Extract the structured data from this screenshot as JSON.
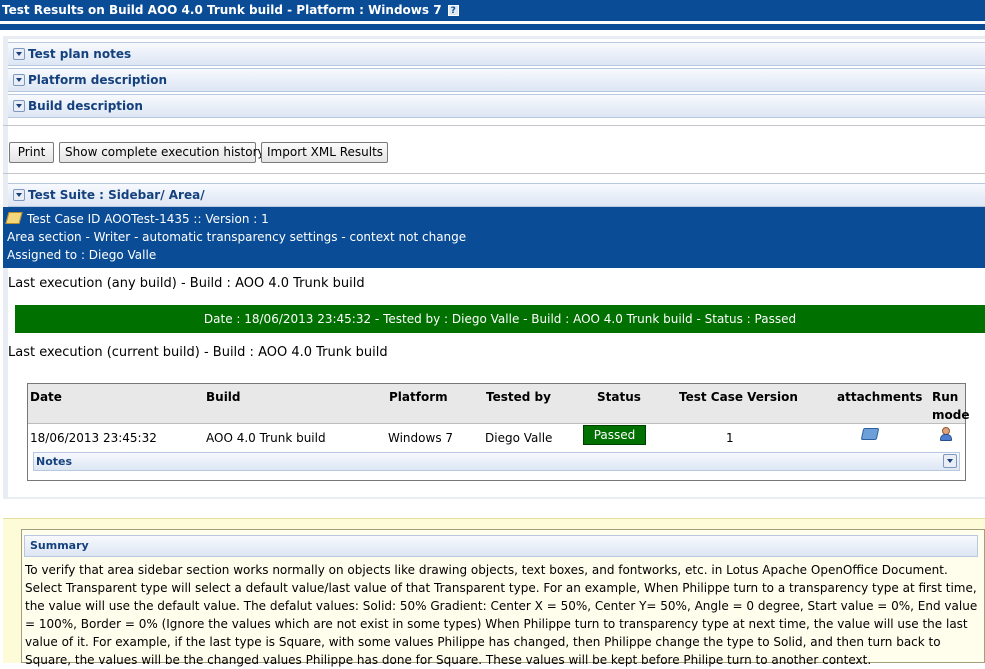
{
  "header": {
    "title": "Test Results on Build AOO 4.0 Trunk build - Platform : Windows 7",
    "help_icon": "?"
  },
  "sections": {
    "test_plan_notes": "Test plan notes",
    "platform_description": "Platform description",
    "build_description": "Build description"
  },
  "toolbar": {
    "print": "Print",
    "history": "Show complete execution history",
    "import_xml": "Import XML Results"
  },
  "test_suite": "Test Suite : Sidebar/ Area/",
  "test_case": {
    "id_line": "Test Case ID AOOTest-1435 :: Version : 1",
    "title": "Area section - Writer - automatic transparency settings - context not change",
    "assigned": "Assigned to : Diego Valle"
  },
  "last_exec_any": "Last execution (any build) - Build : AOO 4.0 Trunk build",
  "exec_banner": "Date : 18/06/2013 23:45:32 - Tested by : Diego Valle - Build : AOO 4.0 Trunk build - Status : Passed",
  "last_exec_current": "Last execution (current build) - Build : AOO 4.0 Trunk build",
  "table": {
    "headers": {
      "date": "Date",
      "build": "Build",
      "platform": "Platform",
      "tested_by": "Tested by",
      "status": "Status",
      "tc_version": "Test Case Version",
      "attachments": "attachments",
      "run_mode_1": "Run",
      "run_mode_2": "mode"
    },
    "row": {
      "date": "18/06/2013 23:45:32",
      "build": "AOO 4.0 Trunk build",
      "platform": "Windows 7",
      "tested_by": "Diego Valle",
      "status": "Passed",
      "tc_version": "1"
    },
    "notes": "Notes"
  },
  "summary": {
    "header": "Summary",
    "text": "To verify that area sidebar section works normally on objects like drawing objects, text boxes, and fontworks, etc. in Lotus Apache OpenOffice Document. Select Transparent type will select a default value/last value of that Transparent type. For an example, When Philippe turn to a transparency type at first time, the value will use the default value. The defalut values: Solid: 50% Gradient: Center X = 50%, Center Y= 50%, Angle = 0 degree, Start value = 0%, End value = 100%, Border = 0% (Ignore the values which are not exist in some types) When Philippe turn to transparency type at next time, the value will use the last value of it. For example, if the last type is Square, with some values Philippe has changed, then Philippe change the type to Solid, and then turn back to Square, the values will be the changed values Philippe has done for Square. These values will be kept before Philipe turn to another context."
  },
  "colors": {
    "header_blue": "#0a4c96",
    "passed_green": "#007000",
    "section_text": "#14417e"
  }
}
